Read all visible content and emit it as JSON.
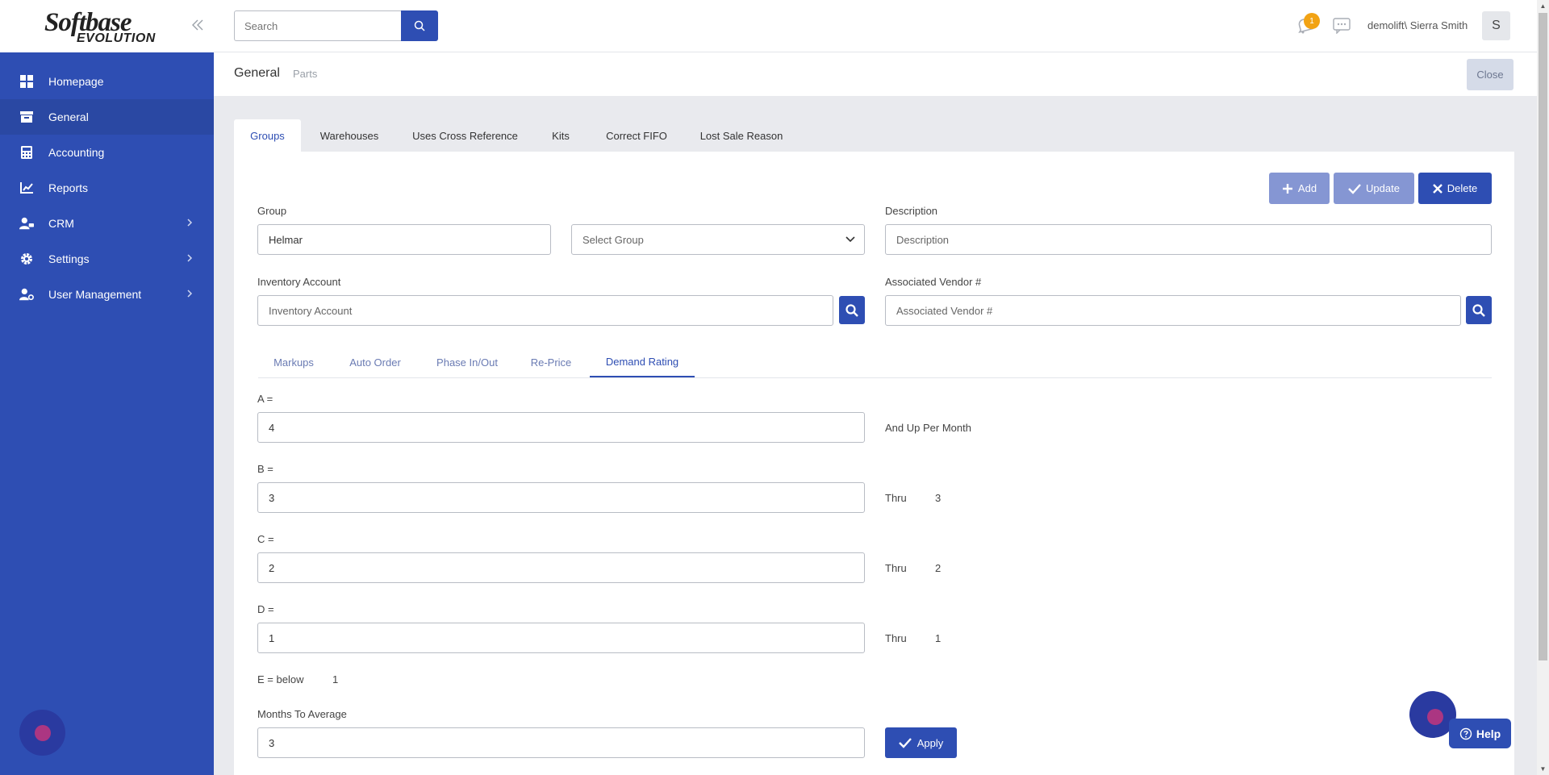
{
  "sidebar": {
    "logo_line1": "Softbase",
    "logo_line2": "EVOLUTION",
    "items": [
      {
        "label": "Homepage"
      },
      {
        "label": "General"
      },
      {
        "label": "Accounting"
      },
      {
        "label": "Reports"
      },
      {
        "label": "CRM"
      },
      {
        "label": "Settings"
      },
      {
        "label": "User Management"
      }
    ]
  },
  "topbar": {
    "search_placeholder": "Search",
    "notification_count": "1",
    "user": "demolift\\ Sierra Smith",
    "avatar_letter": "S"
  },
  "header": {
    "title": "General",
    "subtitle": "Parts",
    "close_label": "Close"
  },
  "tabs": [
    {
      "label": "Groups",
      "active": true
    },
    {
      "label": "Warehouses"
    },
    {
      "label": "Uses Cross Reference"
    },
    {
      "label": "Kits"
    },
    {
      "label": "Correct FIFO"
    },
    {
      "label": "Lost Sale Reason"
    }
  ],
  "actions": {
    "add": "Add",
    "update": "Update",
    "delete": "Delete"
  },
  "form": {
    "group_label": "Group",
    "group_value": "Helmar",
    "select_group": "Select Group",
    "description_label": "Description",
    "description_placeholder": "Description",
    "inventory_label": "Inventory Account",
    "inventory_placeholder": "Inventory Account",
    "vendor_label": "Associated Vendor #",
    "vendor_placeholder": "Associated Vendor #"
  },
  "subtabs": [
    {
      "label": "Markups"
    },
    {
      "label": "Auto Order"
    },
    {
      "label": "Phase In/Out"
    },
    {
      "label": "Re-Price"
    },
    {
      "label": "Demand Rating",
      "active": true
    }
  ],
  "demand": {
    "a_label": "A =",
    "a_value": "4",
    "a_note": "And Up Per Month",
    "b_label": "B =",
    "b_value": "3",
    "b_thru": "Thru",
    "b_thru_value": "3",
    "c_label": "C =",
    "c_value": "2",
    "c_thru": "Thru",
    "c_thru_value": "2",
    "d_label": "D =",
    "d_value": "1",
    "d_thru": "Thru",
    "d_thru_value": "1",
    "e_label": "E = below",
    "e_value": "1",
    "months_label": "Months To Average",
    "months_value": "3",
    "apply_label": "Apply"
  },
  "help_label": "Help",
  "colors": {
    "primary": "#2e4eb3",
    "primary_light": "#8596d3",
    "badge": "#f2a314"
  }
}
